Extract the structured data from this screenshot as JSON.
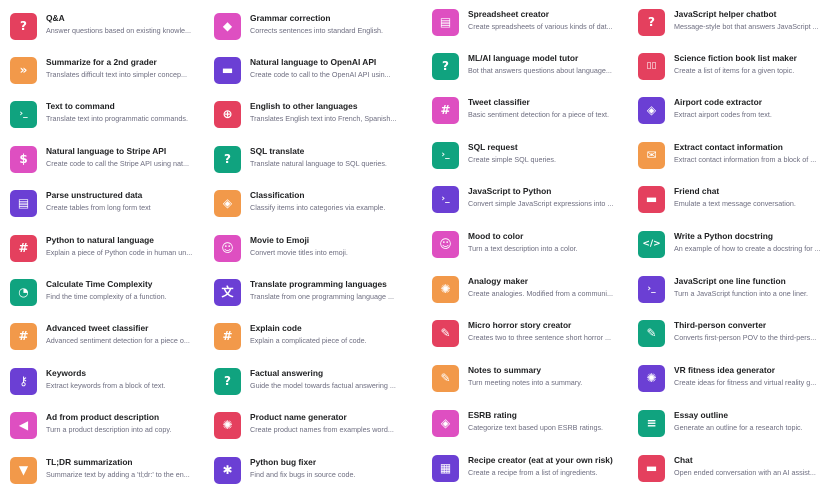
{
  "columns": [
    {
      "items": [
        {
          "title": "Q&A",
          "description": "Answer questions based on existing knowle...",
          "icon": "question-icon",
          "color": "#e4405e"
        },
        {
          "title": "Summarize for a 2nd grader",
          "description": "Translates difficult text into simpler concep...",
          "icon": "fast-forward-icon",
          "color": "#f2994a"
        },
        {
          "title": "Text to command",
          "description": "Translate text into programmatic commands.",
          "icon": "terminal-icon",
          "color": "#10a37f"
        },
        {
          "title": "Natural language to Stripe API",
          "description": "Create code to call the Stripe API using nat...",
          "icon": "dollar-icon",
          "color": "#de4fc1"
        },
        {
          "title": "Parse unstructured data",
          "description": "Create tables from long form text",
          "icon": "table-icon",
          "color": "#6b3fd4"
        },
        {
          "title": "Python to natural language",
          "description": "Explain a piece of Python code in human un...",
          "icon": "hash-icon",
          "color": "#e4405e"
        },
        {
          "title": "Calculate Time Complexity",
          "description": "Find the time complexity of a function.",
          "icon": "clock-icon",
          "color": "#10a37f"
        },
        {
          "title": "Advanced tweet classifier",
          "description": "Advanced sentiment detection for a piece o...",
          "icon": "hash-icon",
          "color": "#f2994a"
        },
        {
          "title": "Keywords",
          "description": "Extract keywords from a block of text.",
          "icon": "key-icon",
          "color": "#6b3fd4"
        },
        {
          "title": "Ad from product description",
          "description": "Turn a product description into ad copy.",
          "icon": "megaphone-icon",
          "color": "#de4fc1"
        },
        {
          "title": "TL;DR summarization",
          "description": "Summarize text by adding a 'tl;dr:' to the en...",
          "icon": "filter-icon",
          "color": "#f2994a"
        }
      ]
    },
    {
      "items": [
        {
          "title": "Grammar correction",
          "description": "Corrects sentences into standard English.",
          "icon": "graduation-cap-icon",
          "color": "#de4fc1"
        },
        {
          "title": "Natural language to OpenAI API",
          "description": "Create code to call to the OpenAI API usin...",
          "icon": "chat-icon",
          "color": "#6b3fd4"
        },
        {
          "title": "English to other languages",
          "description": "Translates English text into French, Spanish...",
          "icon": "globe-icon",
          "color": "#e4405e"
        },
        {
          "title": "SQL translate",
          "description": "Translate natural language to SQL queries.",
          "icon": "question-icon",
          "color": "#10a37f"
        },
        {
          "title": "Classification",
          "description": "Classify items into categories via example.",
          "icon": "tag-icon",
          "color": "#f2994a"
        },
        {
          "title": "Movie to Emoji",
          "description": "Convert movie titles into emoji.",
          "icon": "smile-icon",
          "color": "#de4fc1"
        },
        {
          "title": "Translate programming languages",
          "description": "Translate from one programming language ...",
          "icon": "translate-icon",
          "color": "#6b3fd4"
        },
        {
          "title": "Explain code",
          "description": "Explain a complicated piece of code.",
          "icon": "hash-icon",
          "color": "#f2994a"
        },
        {
          "title": "Factual answering",
          "description": "Guide the model towards factual answering ...",
          "icon": "question-icon",
          "color": "#10a37f"
        },
        {
          "title": "Product name generator",
          "description": "Create product names from examples word...",
          "icon": "lightbulb-icon",
          "color": "#e4405e"
        },
        {
          "title": "Python bug fixer",
          "description": "Find and fix bugs in source code.",
          "icon": "bug-icon",
          "color": "#6b3fd4"
        }
      ]
    },
    {
      "items": [
        {
          "title": "Spreadsheet creator",
          "description": "Create spreadsheets of various kinds of dat...",
          "icon": "table-icon",
          "color": "#de4fc1"
        },
        {
          "title": "ML/AI language model tutor",
          "description": "Bot that answers questions about language...",
          "icon": "question-icon",
          "color": "#10a37f"
        },
        {
          "title": "Tweet classifier",
          "description": "Basic sentiment detection for a piece of text.",
          "icon": "hash-icon",
          "color": "#de4fc1"
        },
        {
          "title": "SQL request",
          "description": "Create simple SQL queries.",
          "icon": "terminal-icon",
          "color": "#10a37f"
        },
        {
          "title": "JavaScript to Python",
          "description": "Convert simple JavaScript expressions into ...",
          "icon": "terminal-icon",
          "color": "#6b3fd4"
        },
        {
          "title": "Mood to color",
          "description": "Turn a text description into a color.",
          "icon": "smile-icon",
          "color": "#de4fc1"
        },
        {
          "title": "Analogy maker",
          "description": "Create analogies. Modified from a communi...",
          "icon": "lightbulb-icon",
          "color": "#f2994a"
        },
        {
          "title": "Micro horror story creator",
          "description": "Creates two to three sentence short horror ...",
          "icon": "pencil-icon",
          "color": "#e4405e"
        },
        {
          "title": "Notes to summary",
          "description": "Turn meeting notes into a summary.",
          "icon": "pencil-icon",
          "color": "#f2994a"
        },
        {
          "title": "ESRB rating",
          "description": "Categorize text based upon ESRB ratings.",
          "icon": "tag-icon",
          "color": "#de4fc1"
        },
        {
          "title": "Recipe creator (eat at your own risk)",
          "description": "Create a recipe from a list of ingredients.",
          "icon": "cake-icon",
          "color": "#6b3fd4"
        }
      ]
    },
    {
      "items": [
        {
          "title": "JavaScript helper chatbot",
          "description": "Message-style bot that answers JavaScript ...",
          "icon": "question-icon",
          "color": "#e4405e"
        },
        {
          "title": "Science fiction book list maker",
          "description": "Create a list of items for a given topic.",
          "icon": "book-icon",
          "color": "#e4405e"
        },
        {
          "title": "Airport code extractor",
          "description": "Extract airport codes from text.",
          "icon": "tag-icon",
          "color": "#6b3fd4"
        },
        {
          "title": "Extract contact information",
          "description": "Extract contact information from a block of ...",
          "icon": "mail-icon",
          "color": "#f2994a"
        },
        {
          "title": "Friend chat",
          "description": "Emulate a text message conversation.",
          "icon": "chat-icon",
          "color": "#e4405e"
        },
        {
          "title": "Write a Python docstring",
          "description": "An example of how to create a docstring for ...",
          "icon": "code-icon",
          "color": "#10a37f"
        },
        {
          "title": "JavaScript one line function",
          "description": "Turn a JavaScript function into a one liner.",
          "icon": "terminal-icon",
          "color": "#6b3fd4"
        },
        {
          "title": "Third-person converter",
          "description": "Converts first-person POV to the third-pers...",
          "icon": "pencil-icon",
          "color": "#10a37f"
        },
        {
          "title": "VR fitness idea generator",
          "description": "Create ideas for fitness and virtual reality g...",
          "icon": "lightbulb-icon",
          "color": "#6b3fd4"
        },
        {
          "title": "Essay outline",
          "description": "Generate an outline for a research topic.",
          "icon": "document-icon",
          "color": "#10a37f"
        },
        {
          "title": "Chat",
          "description": "Open ended conversation with an AI assist...",
          "icon": "chat-icon",
          "color": "#e4405e"
        }
      ]
    }
  ]
}
